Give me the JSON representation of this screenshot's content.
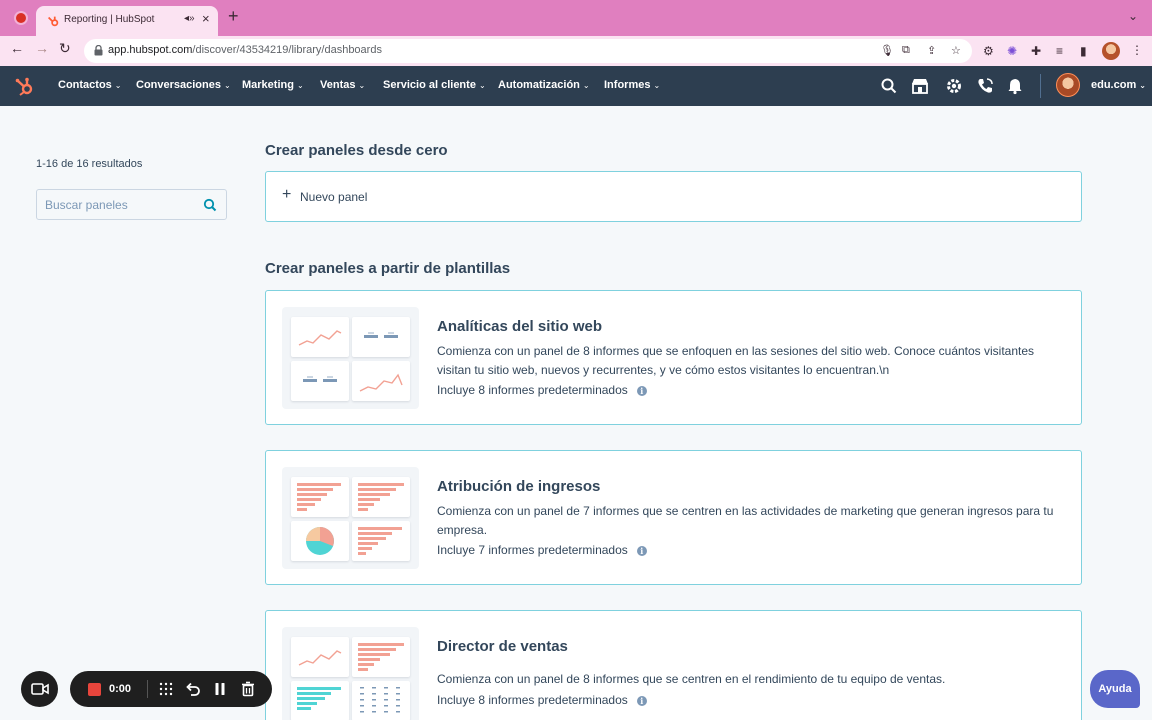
{
  "browser": {
    "tab_title": "Reporting | HubSpot",
    "url_host": "app.hubspot.com",
    "url_path": "/discover/43534219/library/dashboards"
  },
  "hubspot_nav": {
    "items": [
      {
        "label": "Contactos"
      },
      {
        "label": "Conversaciones"
      },
      {
        "label": "Marketing"
      },
      {
        "label": "Ventas"
      },
      {
        "label": "Servicio al cliente"
      },
      {
        "label": "Automatización"
      },
      {
        "label": "Informes"
      }
    ],
    "account": "edu.com"
  },
  "sidebar": {
    "results_text": "1-16 de 16 resultados",
    "search_placeholder": "Buscar paneles"
  },
  "main": {
    "scratch_title": "Crear paneles desde cero",
    "new_panel_label": "Nuevo panel",
    "templates_title": "Crear paneles a partir de plantillas",
    "templates": [
      {
        "title": "Analíticas del sitio web",
        "description": "Comienza con un panel de 8 informes que se enfoquen en las sesiones del sitio web. Conoce cuántos visitantes visitan tu sitio web, nuevos y recurrentes, y ve cómo estos visitantes lo encuentran.\\n",
        "count": "Incluye 8 informes predeterminados"
      },
      {
        "title": "Atribución de ingresos",
        "description": "Comienza con un panel de 7 informes que se centren en las actividades de marketing que generan ingresos para tu empresa.",
        "count": "Incluye 7 informes predeterminados"
      },
      {
        "title": "Director de ventas",
        "description": "Comienza con un panel de 8 informes que se centren en el rendimiento de tu equipo de ventas.",
        "count": "Incluye 8 informes predeterminados"
      }
    ]
  },
  "recorder": {
    "time": "0:00"
  },
  "help": {
    "label": "Ayuda"
  },
  "colors": {
    "nav_bg": "#2d3e50",
    "accent_border": "#7fd1de",
    "chart_coral": "#f2a193",
    "chart_teal": "#4fd4d4",
    "tab_bar": "#e07fbf"
  }
}
